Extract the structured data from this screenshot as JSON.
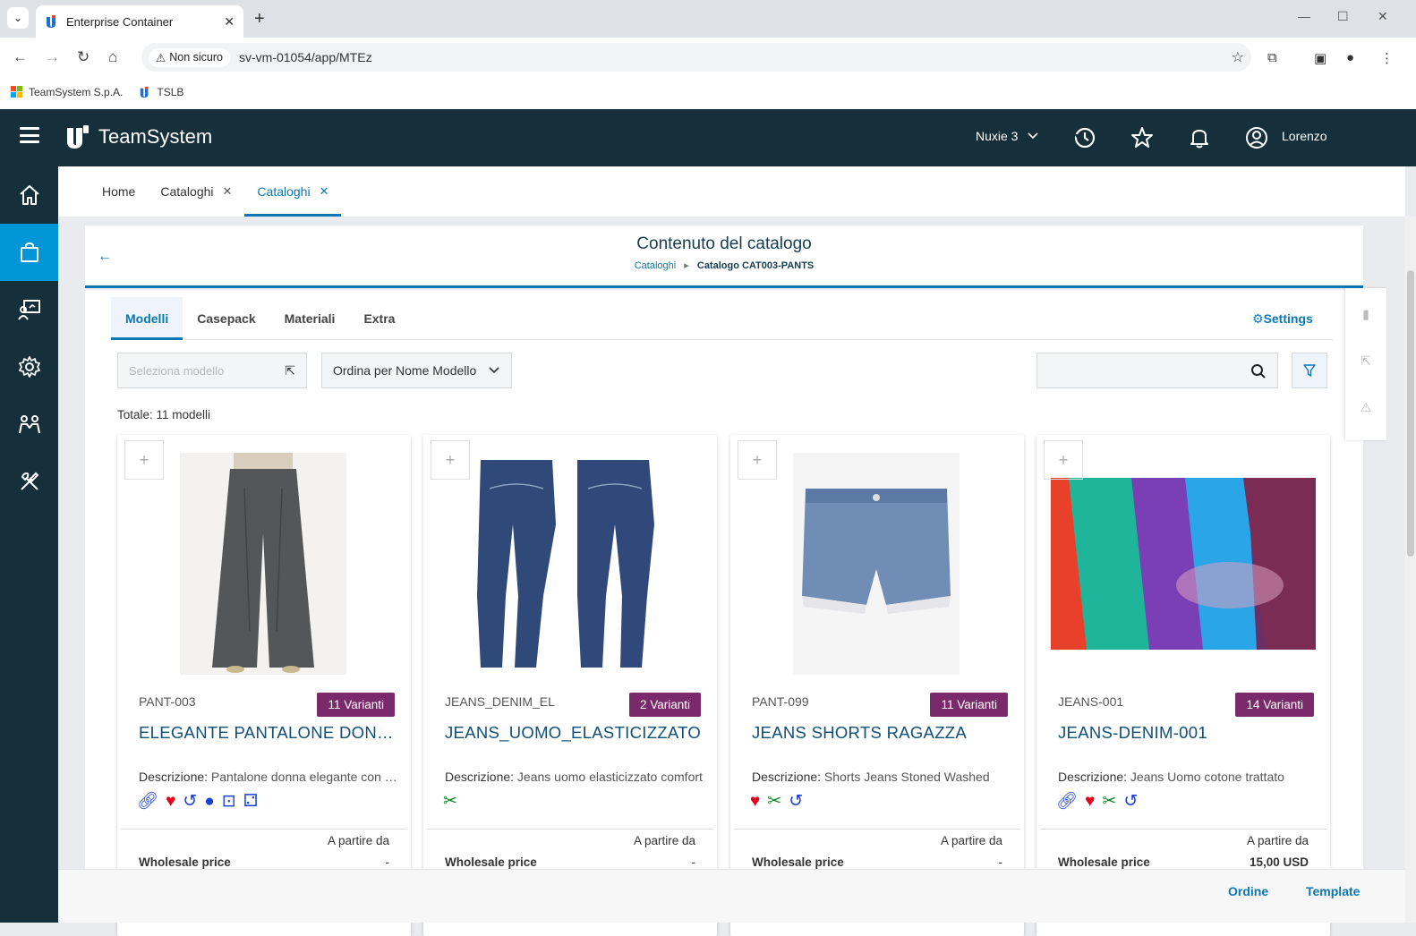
{
  "browser": {
    "tab_title": "Enterprise Container",
    "security_label": "Non sicuro",
    "url": "sv-vm-01054/app/MTEz",
    "bookmarks": [
      {
        "label": "TeamSystem S.p.A."
      },
      {
        "label": "TSLB"
      }
    ]
  },
  "header": {
    "brand": "TeamSystem",
    "company": "Nuxie 3",
    "user": "Lorenzo"
  },
  "sidebar": {
    "items": [
      {
        "icon": "home-icon"
      },
      {
        "icon": "shopping-bag-icon",
        "active": true
      },
      {
        "icon": "presentation-icon"
      },
      {
        "icon": "gear-icon"
      },
      {
        "icon": "team-icon"
      },
      {
        "icon": "tools-icon"
      }
    ]
  },
  "page_tabs": [
    {
      "label": "Home"
    },
    {
      "label": "Cataloghi"
    },
    {
      "label": "Cataloghi",
      "active": true
    }
  ],
  "page": {
    "title": "Contenuto del catalogo",
    "breadcrumb_root": "Cataloghi",
    "breadcrumb_current": "Catalogo CAT003-PANTS"
  },
  "subtabs": [
    {
      "label": "Modelli",
      "active": true
    },
    {
      "label": "Casepack"
    },
    {
      "label": "Materiali"
    },
    {
      "label": "Extra"
    }
  ],
  "settings_label": "Settings",
  "filters": {
    "model_placeholder": "Seleziona modello",
    "sort_value": "Ordina per Nome Modello",
    "search_value": ""
  },
  "totale": "Totale: 11 modelli",
  "cards": [
    {
      "code": "PANT-003",
      "variants": "11 Varianti",
      "name": "ELEGANTE PANTALONE DONNA",
      "desc_label": "Descrizione:",
      "description": "Pantalone donna elegante con pieghe",
      "icons": [
        "link-icon",
        "heart-icon",
        "undo-icon",
        "circle-icon",
        "square-dot-icon",
        "dice-icon"
      ],
      "from_label": "A partire da",
      "price_label": "Wholesale price",
      "price": "-"
    },
    {
      "code": "JEANS_DENIM_EL",
      "variants": "2 Varianti",
      "name": "JEANS_UOMO_ELASTICIZZATO",
      "desc_label": "Descrizione:",
      "description": "Jeans uomo elasticizzato comfort",
      "icons": [
        "scissors-icon"
      ],
      "from_label": "A partire da",
      "price_label": "Wholesale price",
      "price": "-"
    },
    {
      "code": "PANT-099",
      "variants": "11 Varianti",
      "name": "JEANS SHORTS RAGAZZA",
      "desc_label": "Descrizione:",
      "description": "Shorts Jeans Stoned Washed",
      "icons": [
        "heart-icon",
        "scissors-icon",
        "undo-icon"
      ],
      "from_label": "A partire da",
      "price_label": "Wholesale price",
      "price": "-"
    },
    {
      "code": "JEANS-001",
      "variants": "14 Varianti",
      "name": "JEANS-DENIM-001",
      "desc_label": "Descrizione:",
      "description": "Jeans Uomo cotone trattato",
      "icons": [
        "link-icon",
        "heart-icon",
        "scissors-icon",
        "undo-icon"
      ],
      "from_label": "A partire da",
      "price_label": "Wholesale price",
      "price": "15,00 USD"
    }
  ],
  "footer": {
    "ordine_label": "Ordine",
    "template_label": "Template"
  },
  "colors": {
    "header_bg": "#152f3b",
    "accent": "#0b78b5",
    "sidebar_active": "#0396d6",
    "badge": "#7a2a6a"
  }
}
